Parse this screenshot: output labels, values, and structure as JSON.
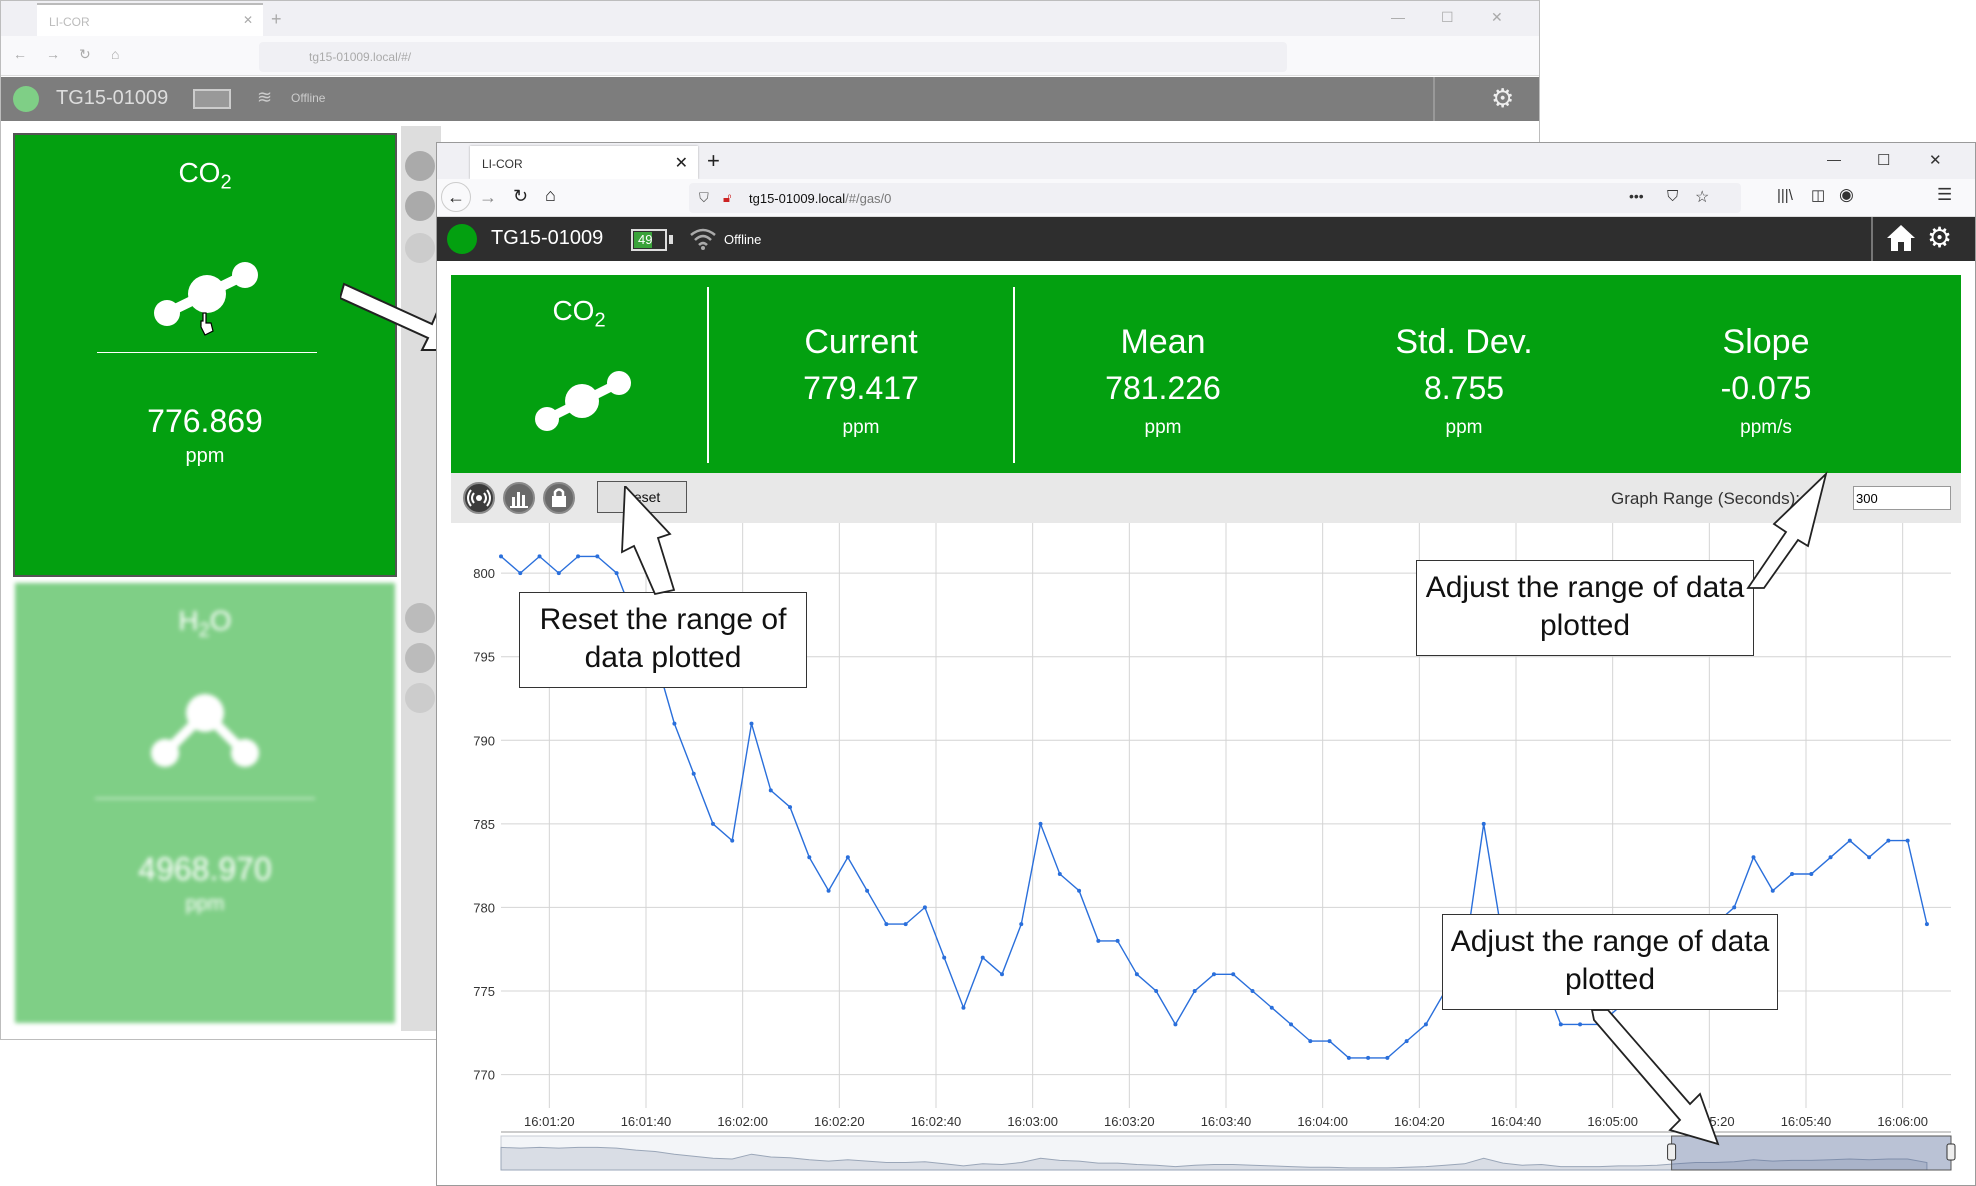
{
  "back_window": {
    "tab_title": "LI-COR",
    "url": "tg15-01009.local/#/",
    "device_name": "TG15-01009",
    "connection_status": "Offline",
    "tiles": [
      {
        "gas_main": "CO",
        "gas_sub": "2",
        "value": "776.869",
        "unit": "ppm"
      },
      {
        "gas_main": "H",
        "gas_sub": "2",
        "gas_tail": "O",
        "value": "4968.970",
        "unit": "ppm"
      }
    ]
  },
  "front_window": {
    "tab_title": "LI-COR",
    "url_host": "tg15-01009.local",
    "url_path": "/#/gas/0",
    "device_name": "TG15-01009",
    "battery_level": "49",
    "connection_status": "Offline",
    "gas": {
      "main": "CO",
      "sub": "2"
    },
    "stats": [
      {
        "label": "Current",
        "value": "779.417",
        "unit": "ppm"
      },
      {
        "label": "Mean",
        "value": "781.226",
        "unit": "ppm"
      },
      {
        "label": "Std. Dev.",
        "value": "8.755",
        "unit": "ppm"
      },
      {
        "label": "Slope",
        "value": "-0.075",
        "unit": "ppm/s"
      }
    ],
    "toolbar": {
      "reset_label": "Reset",
      "range_label": "Graph Range (Seconds):",
      "range_value": "300"
    }
  },
  "callouts": {
    "reset": "Reset the range of data plotted",
    "range_top": "Adjust the range of data plotted",
    "range_bottom": "Adjust the range of data plotted"
  },
  "colors": {
    "brand_green": "#03a010",
    "line_blue": "#2a6fdb"
  },
  "chart_data": {
    "type": "line",
    "ylim": [
      768,
      803
    ],
    "yticks": [
      770,
      775,
      780,
      785,
      790,
      795,
      800
    ],
    "xticks": [
      "16:01:20",
      "16:01:40",
      "16:02:00",
      "16:02:20",
      "16:02:40",
      "16:03:00",
      "16:03:20",
      "16:03:40",
      "16:04:00",
      "16:04:20",
      "16:04:40",
      "16:05:00",
      "16:05:20",
      "16:05:40",
      "16:06:00"
    ],
    "xlim": [
      0,
      301
    ],
    "x": [
      0,
      4,
      8,
      12,
      16,
      20,
      24,
      28,
      32,
      36,
      40,
      44,
      48,
      52,
      56,
      60,
      64,
      68,
      72,
      76,
      80,
      84,
      88,
      92,
      96,
      100,
      104,
      108,
      112,
      116,
      120,
      124,
      128,
      132,
      136,
      140,
      144,
      148,
      152,
      156,
      160,
      164,
      168,
      172,
      176,
      180,
      184,
      188,
      192,
      196,
      200,
      204,
      208,
      212,
      216,
      220,
      224,
      228,
      232,
      236,
      240,
      244,
      248,
      252,
      256,
      260,
      264,
      268,
      272,
      276,
      280,
      284,
      288,
      292,
      296
    ],
    "y": [
      801,
      800,
      801,
      800,
      801,
      801,
      800,
      797,
      795,
      791,
      788,
      785,
      784,
      791,
      787,
      786,
      783,
      781,
      783,
      781,
      779,
      779,
      780,
      777,
      774,
      777,
      776,
      779,
      785,
      782,
      781,
      778,
      778,
      776,
      775,
      773,
      775,
      776,
      776,
      775,
      774,
      773,
      772,
      772,
      771,
      771,
      771,
      772,
      773,
      775,
      777,
      785,
      778,
      775,
      776,
      773,
      773,
      773,
      774,
      774,
      775,
      777,
      779,
      779,
      780,
      783,
      781,
      782,
      782,
      783,
      784,
      783,
      784,
      784,
      779
    ]
  }
}
